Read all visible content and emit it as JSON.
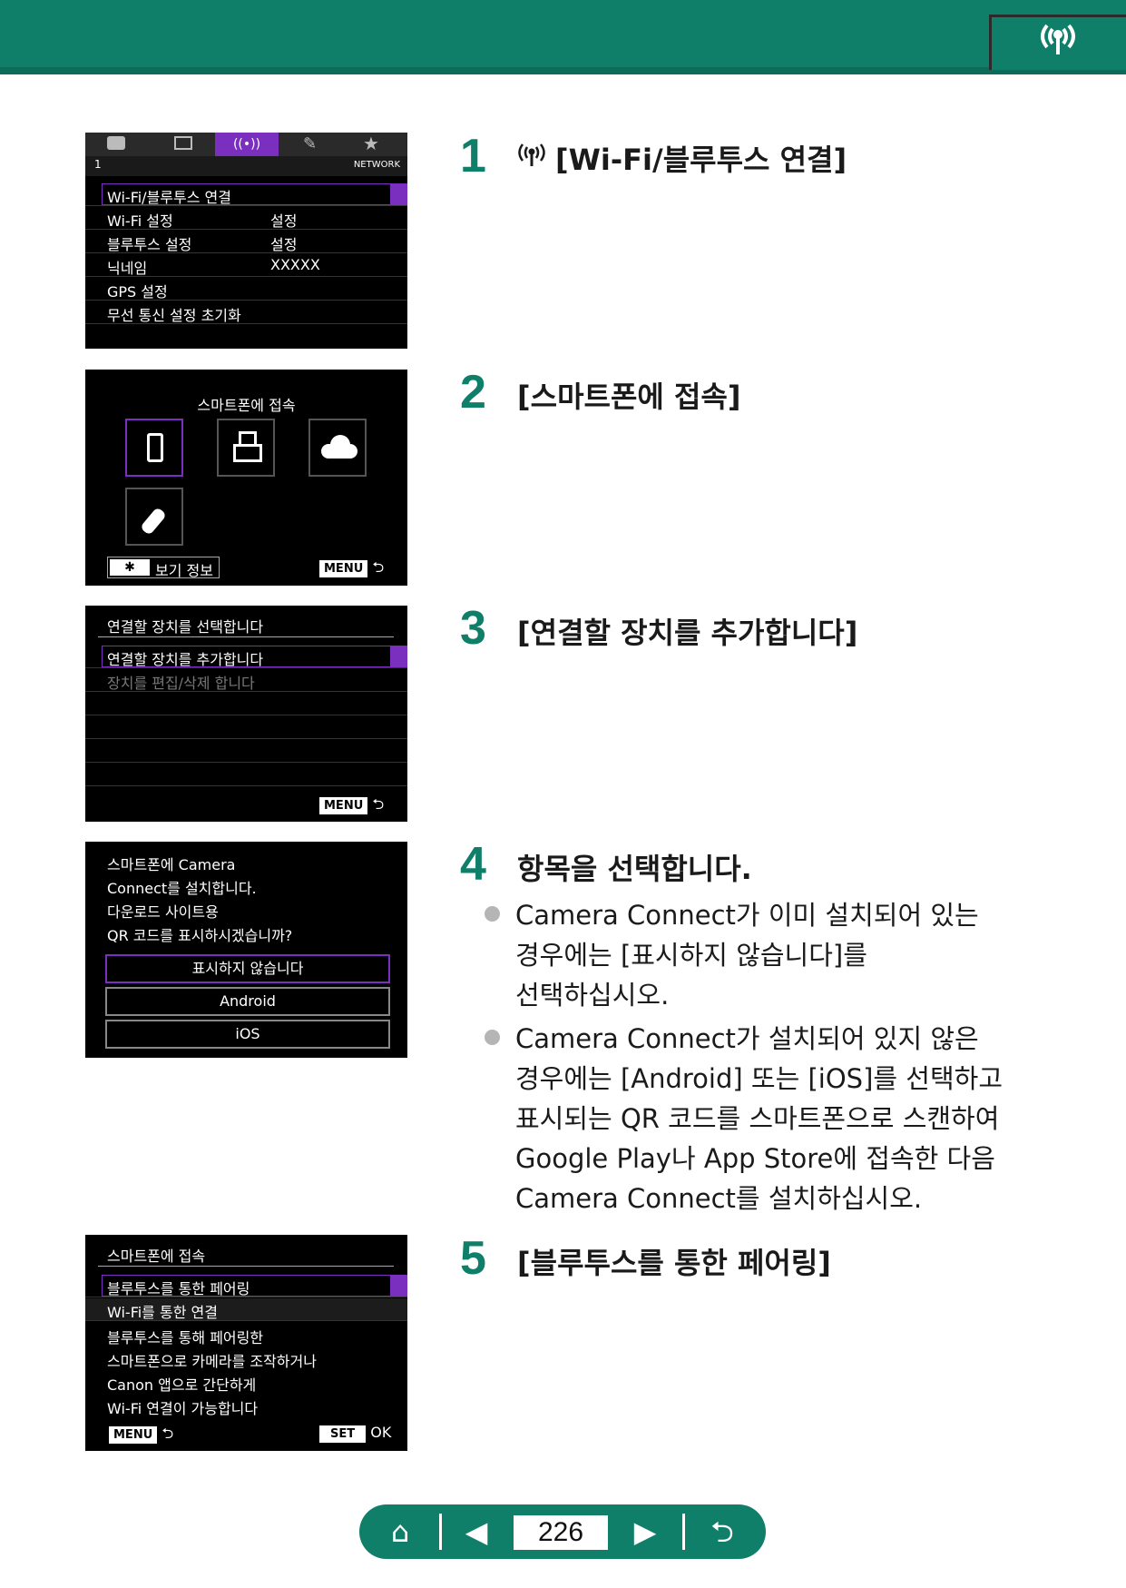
{
  "header": {
    "icon": "wireless-icon"
  },
  "screen1": {
    "tabs": [
      "camera-icon",
      "playback-icon",
      "wireless-icon",
      "settings-icon",
      "star-icon"
    ],
    "tab_index": "1",
    "tab_label": "NETWORK",
    "items": [
      {
        "label": "Wi-Fi/블루투스 연결",
        "value": ""
      },
      {
        "label": "Wi-Fi 설정",
        "value": "설정"
      },
      {
        "label": "블루투스 설정",
        "value": "설정"
      },
      {
        "label": "닉네임",
        "value": "XXXXX"
      },
      {
        "label": "GPS 설정",
        "value": ""
      },
      {
        "label": "무선 통신 설정 초기화",
        "value": ""
      }
    ]
  },
  "screen2": {
    "title": "스마트폰에 접속",
    "info_label": "보기 정보",
    "menu_label": "MENU"
  },
  "screen3": {
    "title": "연결할 장치를 선택합니다",
    "items": [
      "연결할 장치를 추가합니다",
      "장치를 편집/삭제 합니다"
    ],
    "menu_label": "MENU"
  },
  "screen4": {
    "lines": [
      "스마트폰에 Camera",
      "Connect를 설치합니다.",
      "다운로드 사이트용",
      "QR 코드를 표시하시겠습니까?"
    ],
    "options": [
      "표시하지 않습니다",
      "Android",
      "iOS"
    ]
  },
  "screen5": {
    "title": "스마트폰에 접속",
    "items": [
      "블루투스를 통한 페어링",
      "Wi-Fi를 통한 연결"
    ],
    "desc": [
      "블루투스를 통해 페어링한",
      "스마트폰으로 카메라를 조작하거나",
      "Canon 앱으로 간단하게",
      "Wi-Fi 연결이 가능합니다"
    ],
    "menu_label": "MENU",
    "set_label": "SET",
    "ok_label": "OK"
  },
  "steps": [
    {
      "num": "1",
      "title": "[Wi-Fi/블루투스 연결]"
    },
    {
      "num": "2",
      "title": "[스마트폰에 접속]"
    },
    {
      "num": "3",
      "title": "[연결할 장치를 추가합니다]"
    },
    {
      "num": "4",
      "title": "항목을 선택합니다."
    },
    {
      "num": "5",
      "title": "[블루투스를 통한 페어링]"
    }
  ],
  "step4_bullets": [
    [
      "Camera Connect가 이미 설치되어 있는",
      "경우에는 [표시하지 않습니다]를",
      "선택하십시오."
    ],
    [
      "Camera Connect가 설치되어 있지 않은",
      "경우에는 [Android] 또는 [iOS]를 선택하고",
      "표시되는 QR 코드를 스마트폰으로 스캔하여",
      "Google Play나 App Store에 접속한 다음",
      "Camera Connect를 설치하십시오."
    ]
  ],
  "nav": {
    "page": "226"
  }
}
